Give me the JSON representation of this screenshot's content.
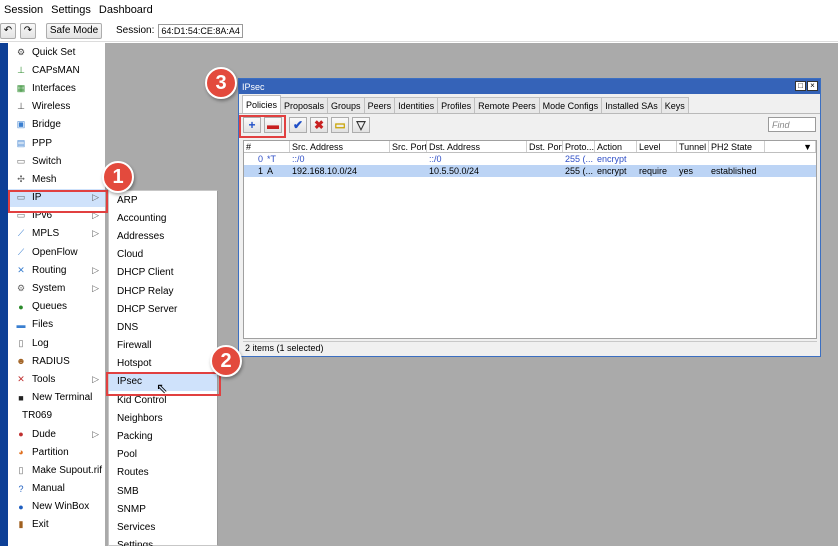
{
  "menubar": {
    "items": [
      "Session",
      "Settings",
      "Dashboard"
    ]
  },
  "toolbar": {
    "undo_icon": "undo-icon",
    "redo_icon": "redo-icon",
    "safe_mode": "Safe Mode",
    "session_label": "Session:",
    "session_value": "64:D1:54:CE:8A:A4"
  },
  "sidebar": {
    "items": [
      {
        "label": "Quick Set",
        "icon": "quickset-icon",
        "glyph": "⚙",
        "color": "#444",
        "arrow": false
      },
      {
        "label": "CAPsMAN",
        "icon": "capsman-icon",
        "glyph": "⊥",
        "color": "#2a8a2a",
        "arrow": false
      },
      {
        "label": "Interfaces",
        "icon": "interfaces-icon",
        "glyph": "▦",
        "color": "#2a8a2a",
        "arrow": false
      },
      {
        "label": "Wireless",
        "icon": "wireless-icon",
        "glyph": "⊥",
        "color": "#444",
        "arrow": false
      },
      {
        "label": "Bridge",
        "icon": "bridge-icon",
        "glyph": "▣",
        "color": "#3a7fd0",
        "arrow": false
      },
      {
        "label": "PPP",
        "icon": "ppp-icon",
        "glyph": "▤",
        "color": "#3a7fd0",
        "arrow": false
      },
      {
        "label": "Switch",
        "icon": "switch-icon",
        "glyph": "▭",
        "color": "#666",
        "arrow": false
      },
      {
        "label": "Mesh",
        "icon": "mesh-icon",
        "glyph": "✣",
        "color": "#666",
        "arrow": false
      },
      {
        "label": "IP",
        "icon": "ip-icon",
        "glyph": "▭",
        "color": "#666",
        "arrow": true
      },
      {
        "label": "IPv6",
        "icon": "ipv6-icon",
        "glyph": "▭",
        "color": "#666",
        "arrow": true
      },
      {
        "label": "MPLS",
        "icon": "mpls-icon",
        "glyph": "⟋",
        "color": "#3a7fd0",
        "arrow": true
      },
      {
        "label": "OpenFlow",
        "icon": "openflow-icon",
        "glyph": "⟋",
        "color": "#3a7fd0",
        "arrow": false
      },
      {
        "label": "Routing",
        "icon": "routing-icon",
        "glyph": "✕",
        "color": "#3a7fd0",
        "arrow": true
      },
      {
        "label": "System",
        "icon": "system-icon",
        "glyph": "⚙",
        "color": "#666",
        "arrow": true
      },
      {
        "label": "Queues",
        "icon": "queues-icon",
        "glyph": "●",
        "color": "#2a8a2a",
        "arrow": false
      },
      {
        "label": "Files",
        "icon": "files-icon",
        "glyph": "▬",
        "color": "#3a7fd0",
        "arrow": false
      },
      {
        "label": "Log",
        "icon": "log-icon",
        "glyph": "▯",
        "color": "#666",
        "arrow": false
      },
      {
        "label": "RADIUS",
        "icon": "radius-icon",
        "glyph": "☻",
        "color": "#a06020",
        "arrow": false
      },
      {
        "label": "Tools",
        "icon": "tools-icon",
        "glyph": "✕",
        "color": "#c03030",
        "arrow": true
      },
      {
        "label": "New Terminal",
        "icon": "terminal-icon",
        "glyph": "■",
        "color": "#222",
        "arrow": false
      },
      {
        "label": "TR069",
        "icon": "",
        "glyph": "",
        "color": "#000",
        "arrow": false
      },
      {
        "label": "Dude",
        "icon": "dude-icon",
        "glyph": "●",
        "color": "#c03030",
        "arrow": true
      },
      {
        "label": "Partition",
        "icon": "partition-icon",
        "glyph": "◕",
        "color": "#e07020",
        "arrow": false
      },
      {
        "label": "Make Supout.rif",
        "icon": "supout-icon",
        "glyph": "▯",
        "color": "#666",
        "arrow": false
      },
      {
        "label": "Manual",
        "icon": "manual-icon",
        "glyph": "?",
        "color": "#1f5fc0",
        "arrow": false
      },
      {
        "label": "New WinBox",
        "icon": "winbox-icon",
        "glyph": "●",
        "color": "#1f5fc0",
        "arrow": false
      },
      {
        "label": "Exit",
        "icon": "exit-icon",
        "glyph": "▮",
        "color": "#a06020",
        "arrow": false
      }
    ]
  },
  "ip_submenu": {
    "items": [
      "ARP",
      "Accounting",
      "Addresses",
      "Cloud",
      "DHCP Client",
      "DHCP Relay",
      "DHCP Server",
      "DNS",
      "Firewall",
      "Hotspot",
      "IPsec",
      "Kid Control",
      "Neighbors",
      "Packing",
      "Pool",
      "Routes",
      "SMB",
      "SNMP",
      "Services",
      "Settings"
    ]
  },
  "ipsec_window": {
    "title": "IPsec",
    "tabs": [
      "Policies",
      "Proposals",
      "Groups",
      "Peers",
      "Identities",
      "Profiles",
      "Remote Peers",
      "Mode Configs",
      "Installed SAs",
      "Keys"
    ],
    "find_placeholder": "Find",
    "columns": [
      "#",
      "Src. Address",
      "Src. Port",
      "Dst. Address",
      "Dst. Port",
      "Proto...",
      "Action",
      "Level",
      "Tunnel",
      "PH2 State"
    ],
    "rows": [
      {
        "num": "0",
        "flags": "*T",
        "src": "::/0",
        "src_port": "",
        "dst": "::/0",
        "dst_port": "",
        "proto": "255 (...",
        "action": "encrypt",
        "level": "",
        "tunnel": "",
        "ph2": ""
      },
      {
        "num": "1",
        "flags": "A",
        "src": "192.168.10.0/24",
        "src_port": "",
        "dst": "10.5.50.0/24",
        "dst_port": "",
        "proto": "255 (...",
        "action": "encrypt",
        "level": "require",
        "tunnel": "yes",
        "ph2": "established"
      }
    ],
    "status": "2 items (1 selected)"
  },
  "annotations": {
    "step1": "1",
    "step2": "2",
    "step3": "3"
  },
  "colors": {
    "accent_red": "#e34a3d",
    "title_blue": "#3563b8",
    "strip_blue": "#0d3f96",
    "desktop": "#aaaaaa"
  }
}
